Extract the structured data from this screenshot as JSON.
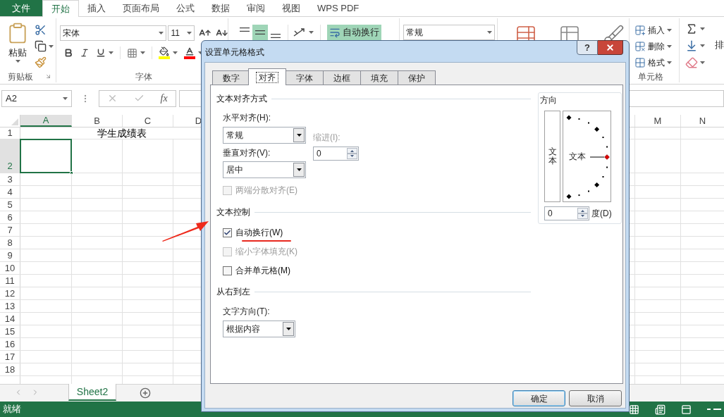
{
  "ribbon_tabs": [
    {
      "label": "文件",
      "kind": "file",
      "selected": false
    },
    {
      "label": "开始",
      "kind": "tab",
      "selected": true
    },
    {
      "label": "插入",
      "kind": "tab",
      "selected": false
    },
    {
      "label": "页面布局",
      "kind": "tab",
      "selected": false
    },
    {
      "label": "公式",
      "kind": "tab",
      "selected": false
    },
    {
      "label": "数据",
      "kind": "tab",
      "selected": false
    },
    {
      "label": "审阅",
      "kind": "tab",
      "selected": false
    },
    {
      "label": "视图",
      "kind": "tab",
      "selected": false
    },
    {
      "label": "WPS PDF",
      "kind": "tab",
      "selected": false
    }
  ],
  "clipboard": {
    "paste": "粘贴",
    "label": "剪贴板"
  },
  "font": {
    "name": "宋体",
    "size": "11",
    "label": "字体"
  },
  "alignment": {
    "buttons": [
      {
        "kind": "top",
        "on": false
      },
      {
        "kind": "middle",
        "on": true
      },
      {
        "kind": "bottom",
        "on": false
      }
    ],
    "wrap_text": {
      "label": "自动换行",
      "on": true
    }
  },
  "number": {
    "format": "常规"
  },
  "cells": {
    "items": [
      {
        "kind": "insert",
        "label": "插入"
      },
      {
        "kind": "delete",
        "label": "删除"
      },
      {
        "kind": "format",
        "label": "格式"
      }
    ],
    "label": "单元格"
  },
  "editing": {
    "sort_label": "排"
  },
  "formula_bar": {
    "name_box": "A2",
    "function_label": "fx"
  },
  "sheet": {
    "columns": [
      {
        "label": "A",
        "selected": true
      },
      {
        "label": "B",
        "selected": false
      },
      {
        "label": "C",
        "selected": false
      },
      {
        "label": "D",
        "selected": false
      },
      {
        "label": "M",
        "selected": false
      },
      {
        "label": "N",
        "selected": false
      }
    ],
    "rows": [
      {
        "label": "1",
        "selected": false,
        "text": "学生成绩表"
      },
      {
        "label": "2",
        "selected": true
      },
      {
        "label": "3",
        "selected": false
      },
      {
        "label": "4",
        "selected": false
      },
      {
        "label": "5",
        "selected": false
      },
      {
        "label": "6",
        "selected": false
      },
      {
        "label": "7",
        "selected": false
      },
      {
        "label": "8",
        "selected": false
      },
      {
        "label": "9",
        "selected": false
      },
      {
        "label": "10",
        "selected": false
      },
      {
        "label": "11",
        "selected": false
      },
      {
        "label": "12",
        "selected": false
      },
      {
        "label": "13",
        "selected": false
      },
      {
        "label": "14",
        "selected": false
      },
      {
        "label": "15",
        "selected": false
      },
      {
        "label": "16",
        "selected": false
      },
      {
        "label": "17",
        "selected": false
      },
      {
        "label": "18",
        "selected": false
      }
    ]
  },
  "sheet_tabs": [
    {
      "label": "Sheet2",
      "selected": true
    }
  ],
  "status_bar": {
    "text": "就绪"
  },
  "dialog": {
    "title": "设置单元格格式",
    "help": "?",
    "tabs": [
      {
        "label": "数字",
        "selected": false
      },
      {
        "label": "对齐",
        "selected": true
      },
      {
        "label": "字体",
        "selected": false
      },
      {
        "label": "边框",
        "selected": false
      },
      {
        "label": "填充",
        "selected": false
      },
      {
        "label": "保护",
        "selected": false
      }
    ],
    "alignment_section": {
      "title": "文本对齐方式",
      "horizontal": {
        "label": "水平对齐(H):",
        "value": "常规"
      },
      "indent": {
        "label": "缩进(I):",
        "value": "0",
        "disabled": true
      },
      "vertical": {
        "label": "垂直对齐(V):",
        "value": "居中"
      },
      "justify_distributed": {
        "label": "两端分散对齐(E)",
        "checked": false,
        "disabled": true
      }
    },
    "text_control": {
      "title": "文本控制",
      "options": [
        {
          "label": "自动换行(W)",
          "checked": true,
          "disabled": false
        },
        {
          "label": "缩小字体填充(K)",
          "checked": false,
          "disabled": true
        },
        {
          "label": "合并单元格(M)",
          "checked": false,
          "disabled": false
        }
      ]
    },
    "rtl": {
      "title": "从右到左",
      "direction": {
        "label": "文字方向(T):",
        "value": "根据内容"
      }
    },
    "orientation": {
      "title": "方向",
      "vertical_sample": "文本",
      "dial_sample": "文本",
      "degrees": {
        "value": "0",
        "label": "度(D)"
      }
    },
    "buttons": [
      {
        "label": "确定",
        "kind": "default"
      },
      {
        "label": "取消",
        "kind": "normal"
      }
    ]
  }
}
